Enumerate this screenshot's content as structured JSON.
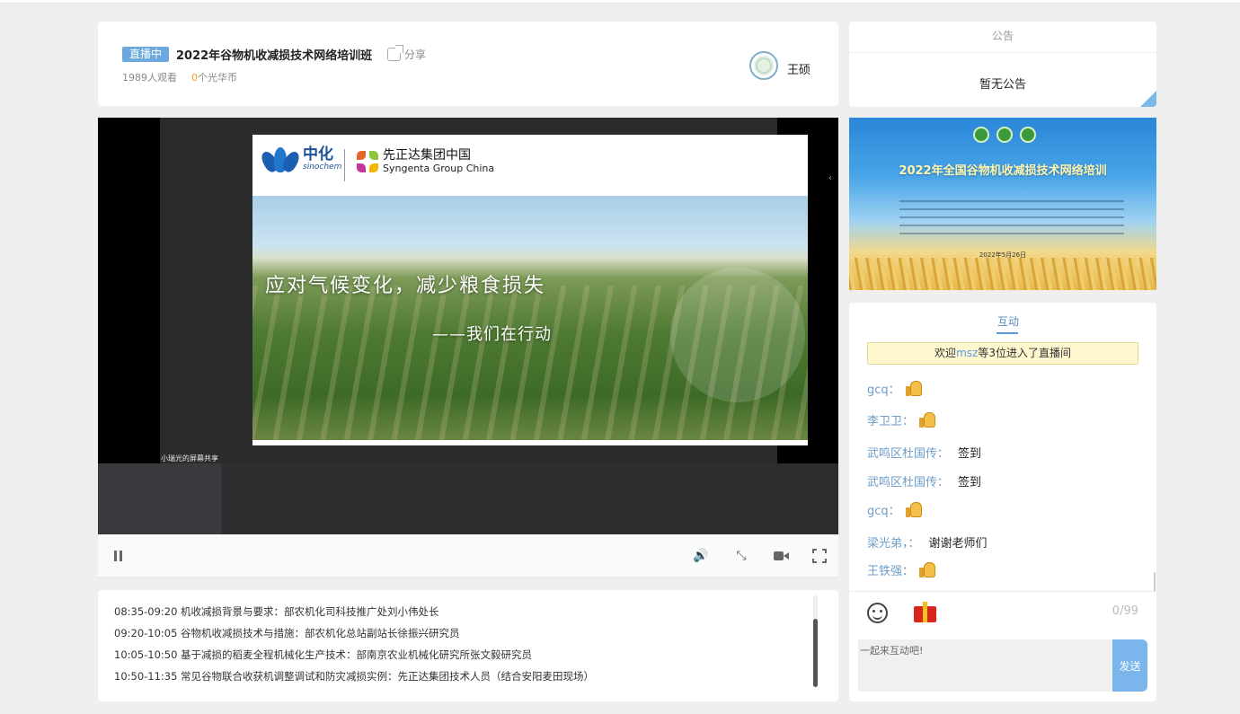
{
  "header": {
    "live_badge": "直播中",
    "title": "2022年谷物机收减损技术网络培训班",
    "share_label": "分享",
    "viewers": "1989人观看",
    "coin_count": "0",
    "coin_unit": "个光华币",
    "host_name": "王硕"
  },
  "announcement": {
    "title": "公告",
    "body": "暂无公告"
  },
  "player": {
    "slide_main_text": "应对气候变化，减少粮食损失",
    "slide_sub_text": "——我们在行动",
    "logo1_name": "中化",
    "logo1_sub": "sinochem",
    "logo2_name": "先正达集团中国",
    "logo2_en": "Syngenta Group China",
    "share_caption": "小瑞光的屏幕共享",
    "controls": {
      "pause_icon": "pause-icon",
      "volume_icon": "volume-icon",
      "signal_icon": "signal-icon",
      "camera_icon": "camera-icon",
      "fullscreen_icon": "fullscreen-icon"
    }
  },
  "schedule": [
    {
      "time": "08:35-09:20",
      "topic": "机收减损背景与要求：部农机化司科技推广处刘小伟处长"
    },
    {
      "time": "09:20-10:05",
      "topic": "谷物机收减损技术与措施：部农机化总站副站长徐振兴研究员"
    },
    {
      "time": "10:05-10:50",
      "topic": "基于减损的稻麦全程机械化生产技术：部南京农业机械化研究所张文毅研究员"
    },
    {
      "time": "10:50-11:35",
      "topic": "常见谷物联合收获机调整调试和防灾减损实例：先正达集团技术人员（结合安阳麦田现场）"
    }
  ],
  "banner": {
    "title": "2022年全国谷物机收减损技术网络培训",
    "date": "2022年5月26日"
  },
  "chat": {
    "tab_label": "互动",
    "welcome_prefix": "欢迎",
    "welcome_user": "msz",
    "welcome_suffix": "等3位进入了直播间",
    "messages": [
      {
        "user": "gcq：",
        "text": "",
        "thumb": true
      },
      {
        "user": "李卫卫：",
        "text": "",
        "thumb": true
      },
      {
        "user": "武鸣区杜国传：",
        "text": "签到",
        "thumb": false
      },
      {
        "user": "武鸣区杜国传：",
        "text": "签到",
        "thumb": false
      },
      {
        "user": "gcq：",
        "text": "",
        "thumb": true
      },
      {
        "user": "梁光弟，：",
        "text": "谢谢老师们",
        "thumb": false
      },
      {
        "user": "王铁强：",
        "text": "",
        "thumb": true
      }
    ],
    "char_count": "0/99",
    "input_placeholder": "一起来互动吧!",
    "send_label": "发送",
    "accent_color": "#7ab6ec"
  }
}
